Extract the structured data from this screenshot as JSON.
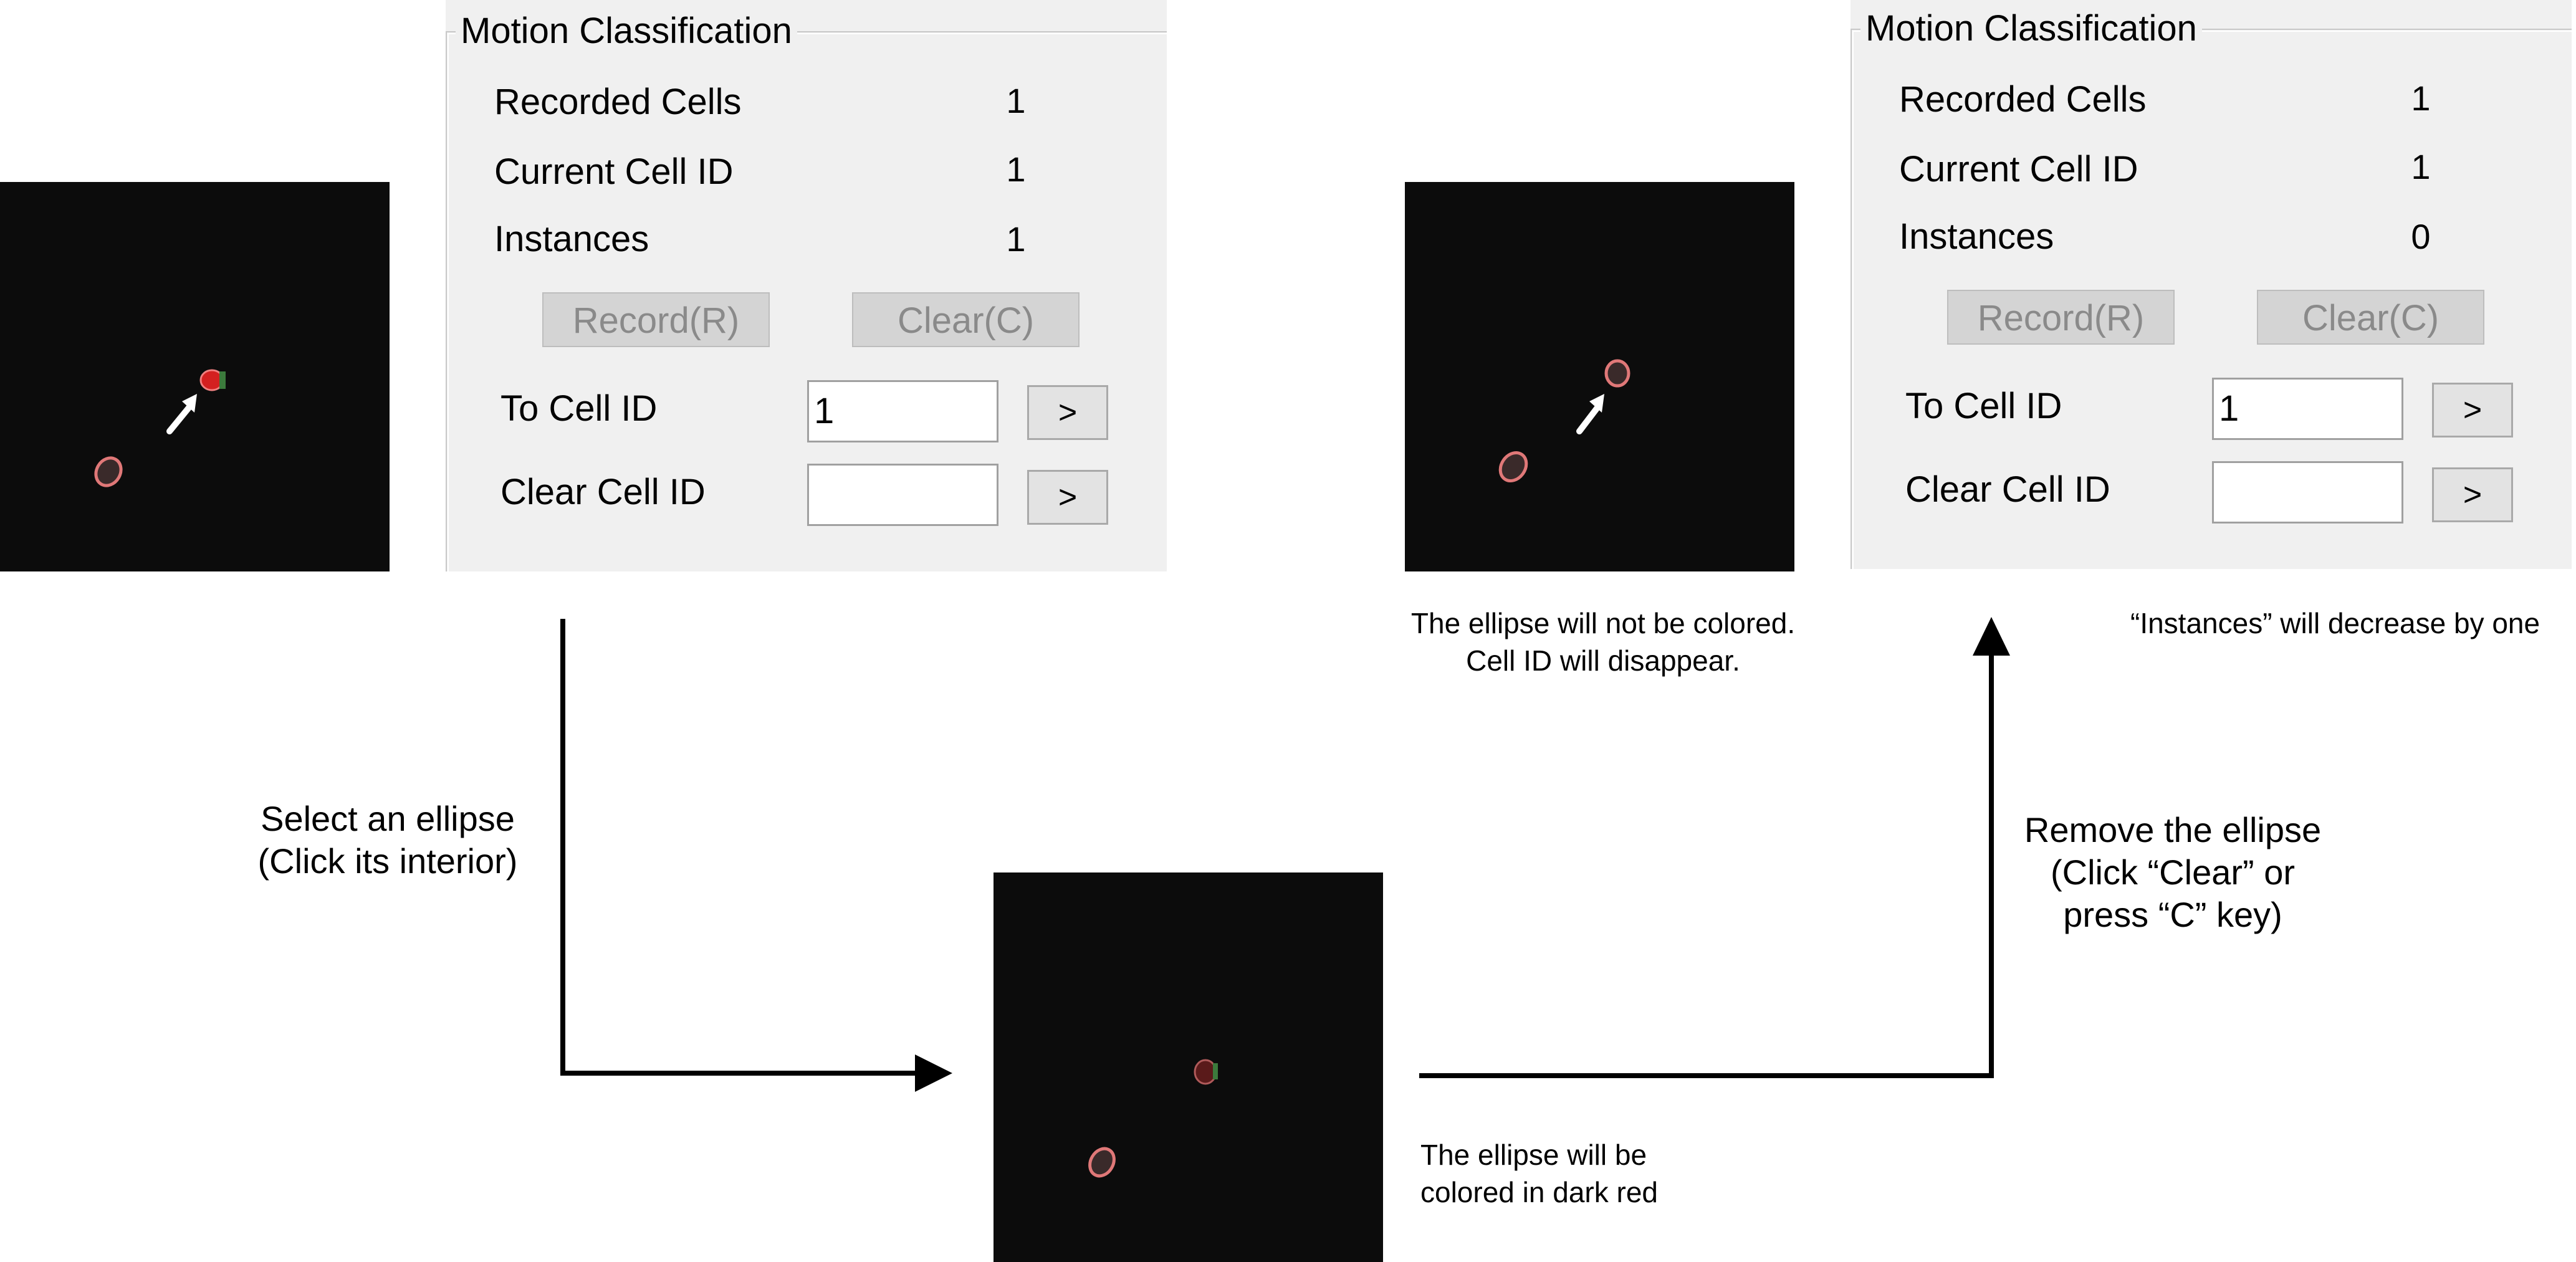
{
  "panel_left": {
    "title": "Motion Classification",
    "recorded_cells_label": "Recorded Cells",
    "recorded_cells_value": "1",
    "current_cell_label": "Current Cell ID",
    "current_cell_value": "1",
    "instances_label": "Instances",
    "instances_value": "1",
    "record_button": "Record(R)",
    "clear_button": "Clear(C)",
    "to_cell_label": "To Cell ID",
    "to_cell_value": "1",
    "clear_cell_label": "Clear Cell ID",
    "clear_cell_value": "",
    "go_label": ">"
  },
  "panel_right": {
    "title": "Motion Classification",
    "recorded_cells_label": "Recorded Cells",
    "recorded_cells_value": "1",
    "current_cell_label": "Current Cell ID",
    "current_cell_value": "1",
    "instances_label": "Instances",
    "instances_value": "0",
    "record_button": "Record(R)",
    "clear_button": "Clear(C)",
    "to_cell_label": "To Cell ID",
    "to_cell_value": "1",
    "clear_cell_label": "Clear Cell ID",
    "clear_cell_value": "",
    "go_label": ">"
  },
  "captions": {
    "select_line1": "Select an ellipse",
    "select_line2": "(Click its interior)",
    "colored_line1": "The ellipse will be",
    "colored_line2": "colored in dark red",
    "remove_line1": "Remove the ellipse",
    "remove_line2": "(Click “Clear” or",
    "remove_line3": "press “C” key)",
    "not_colored_line1": "The ellipse will not be colored.",
    "not_colored_line2": "Cell ID will disappear.",
    "instances_decrease": "“Instances” will decrease by one"
  },
  "colors": {
    "image_background": "#0c0c0c",
    "selected_ellipse": "#d42020",
    "dark_red_ellipse": "#5a1a1a",
    "ellipse_outline": "#e07878",
    "panel_background": "#f0f0f0",
    "disabled_text": "#8a8a8a"
  },
  "icons": [
    "pointer-arrow-icon",
    "flow-arrow-icon"
  ]
}
